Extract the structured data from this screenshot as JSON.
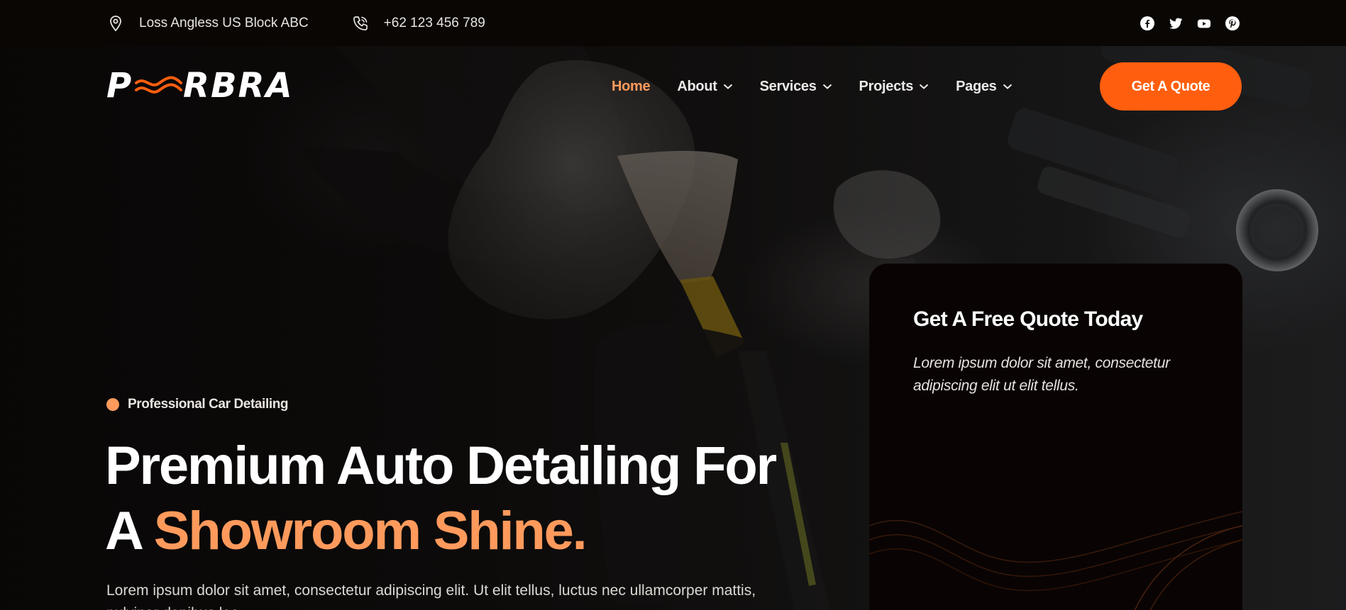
{
  "topbar": {
    "address": "Loss Angless US Block ABC",
    "phone": "+62 123 456 789",
    "social": [
      {
        "icon": "facebook-icon"
      },
      {
        "icon": "twitter-icon"
      },
      {
        "icon": "youtube-icon"
      },
      {
        "icon": "pinterest-icon"
      }
    ]
  },
  "brand": {
    "logo_text": "PURBRA",
    "accent_color": "#ff5e0e",
    "highlight_color": "#ff9a5c"
  },
  "nav": {
    "items": [
      {
        "label": "Home",
        "active": true,
        "dropdown": false
      },
      {
        "label": "About",
        "active": false,
        "dropdown": true
      },
      {
        "label": "Services",
        "active": false,
        "dropdown": true
      },
      {
        "label": "Projects",
        "active": false,
        "dropdown": true
      },
      {
        "label": "Pages",
        "active": false,
        "dropdown": true
      }
    ],
    "cta_label": "Get A Quote"
  },
  "hero": {
    "badge": "Professional Car Detailing",
    "headline_line1": "Premium Auto Detailing For",
    "headline_line2_prefix": "A ",
    "headline_line2_accent": "Showroom Shine.",
    "lede": "Lorem ipsum dolor sit amet, consectetur adipiscing elit. Ut elit tellus, luctus nec ullamcorper mattis, pulvinar dapibus leo."
  },
  "quote_card": {
    "title": "Get A Free Quote Today",
    "text": "Lorem ipsum dolor sit amet, consectetur adipiscing elit ut elit tellus."
  }
}
